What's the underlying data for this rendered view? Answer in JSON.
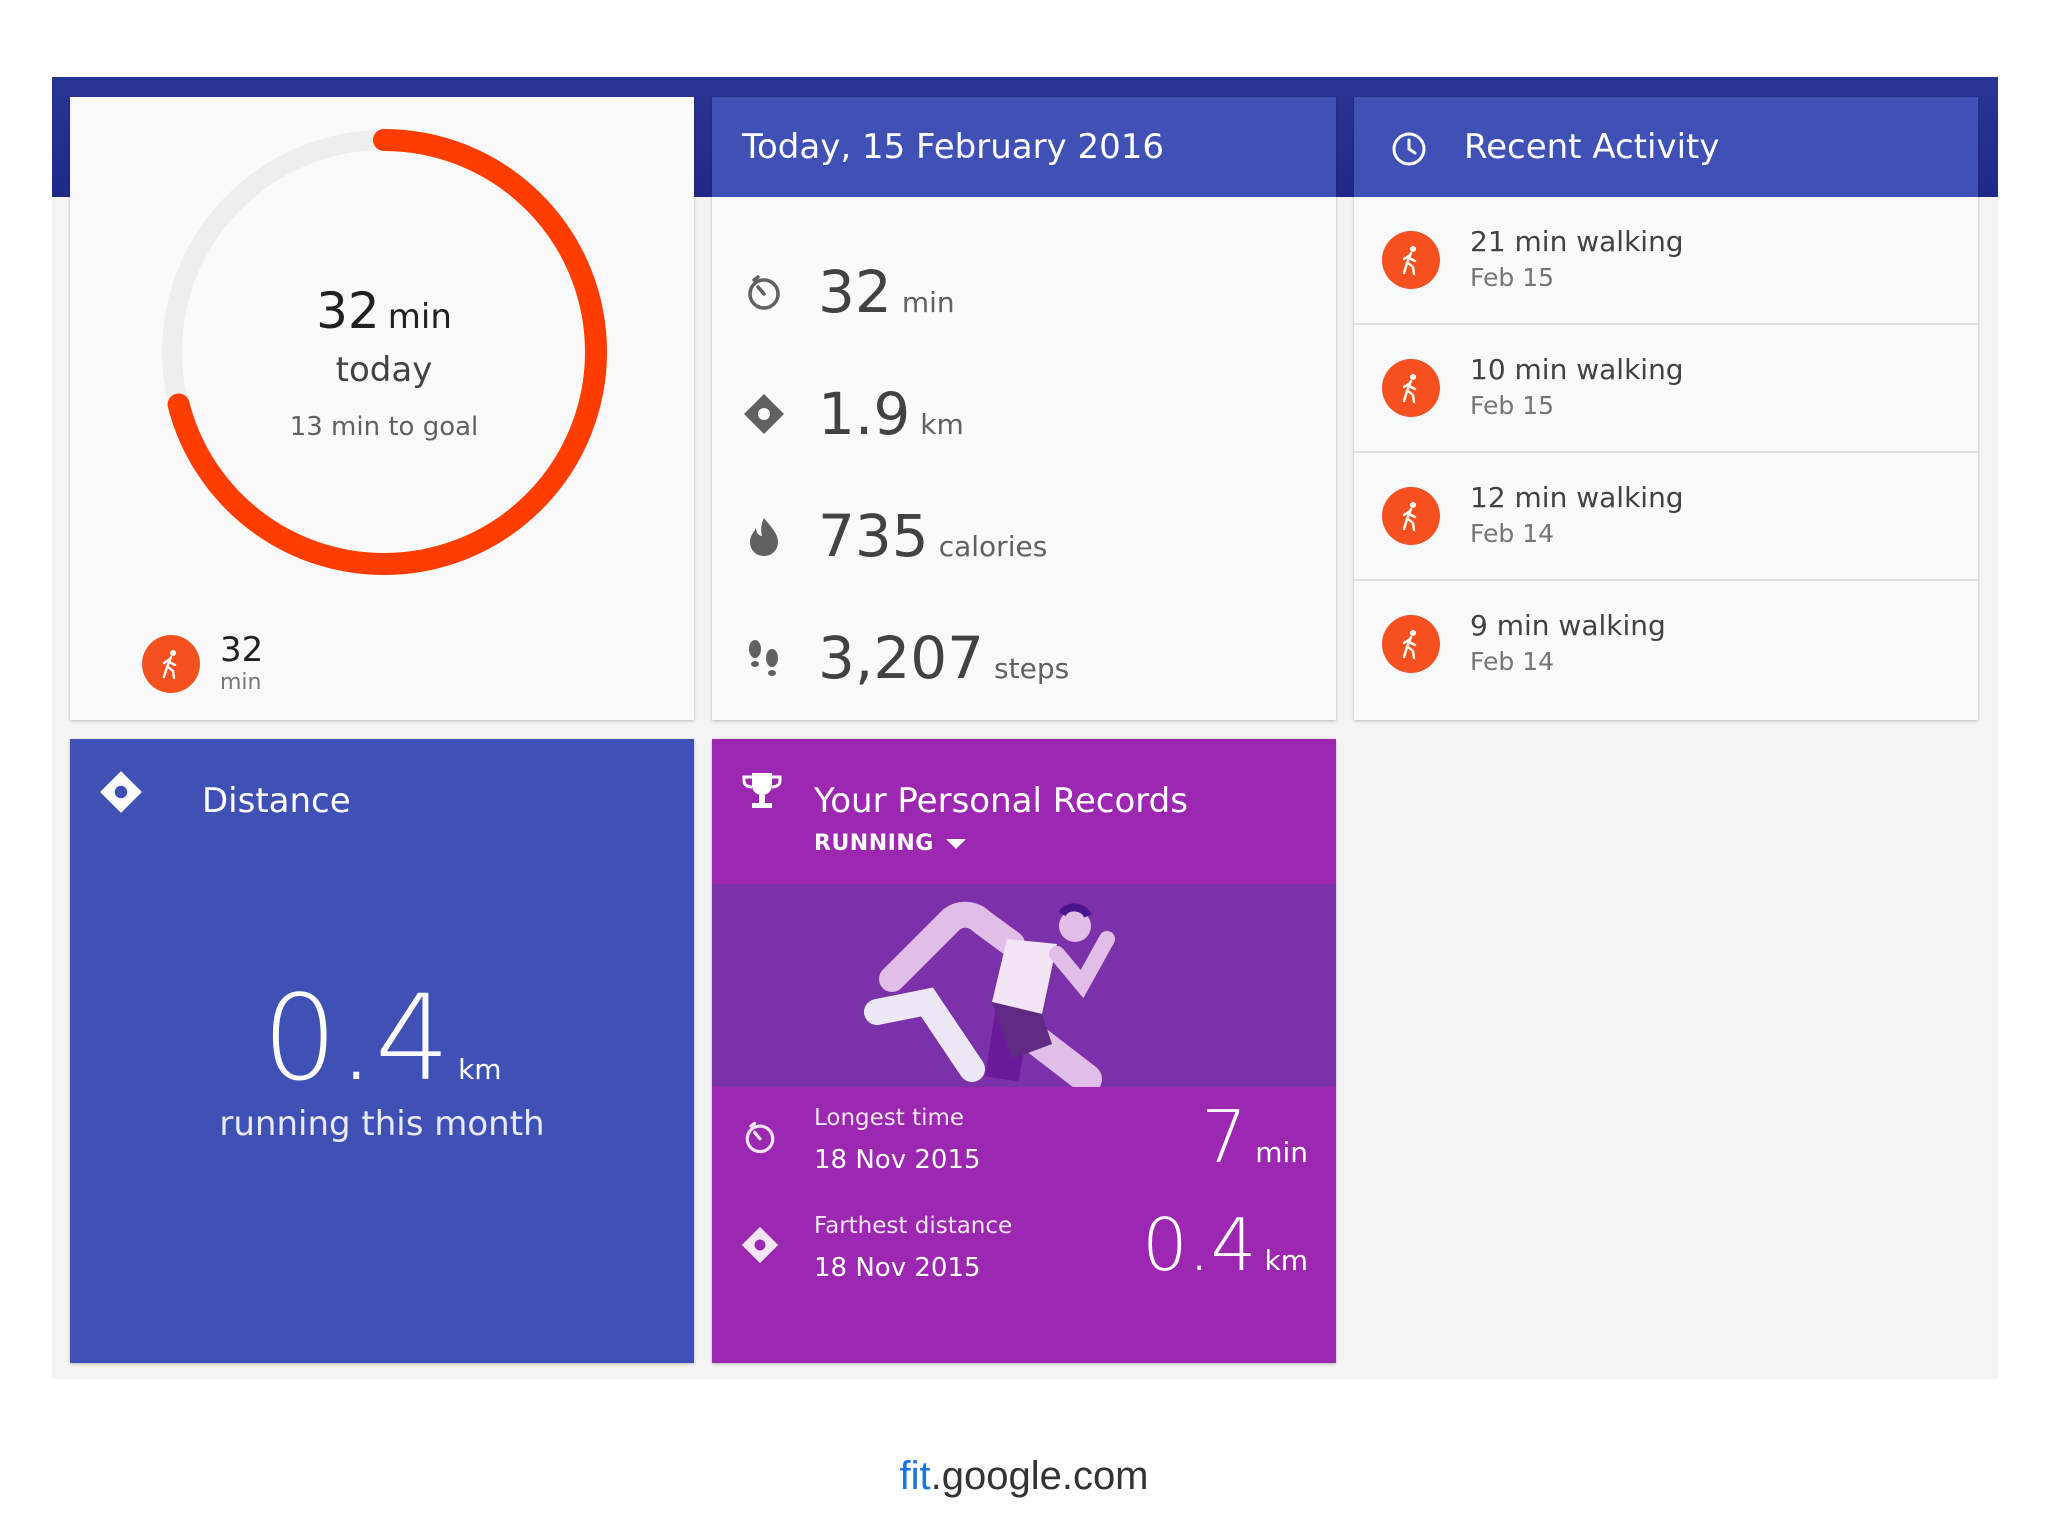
{
  "goal": {
    "value": "32",
    "unit": "min",
    "label": "today",
    "remaining": "13 min to goal",
    "progress": 0.71,
    "mini_value": "32",
    "mini_unit": "min",
    "ring_color": "#ff3d00"
  },
  "today": {
    "title": "Today, 15 February 2016",
    "stats": [
      {
        "icon": "timer-icon",
        "value": "32",
        "unit": "min"
      },
      {
        "icon": "pin-icon",
        "value": "1.9",
        "unit": "km"
      },
      {
        "icon": "flame-icon",
        "value": "735",
        "unit": "calories"
      },
      {
        "icon": "footsteps-icon",
        "value": "3,207",
        "unit": "steps"
      }
    ]
  },
  "recent": {
    "title": "Recent Activity",
    "items": [
      {
        "title": "21 min walking",
        "date": "Feb 15"
      },
      {
        "title": "10 min walking",
        "date": "Feb 15"
      },
      {
        "title": "12 min walking",
        "date": "Feb 14"
      },
      {
        "title": "9 min walking",
        "date": "Feb 14"
      }
    ]
  },
  "distance": {
    "title": "Distance",
    "value": "0.4",
    "unit": "km",
    "subtitle": "running this month"
  },
  "records": {
    "title": "Your Personal Records",
    "sport": "RUNNING",
    "rows": [
      {
        "label": "Longest time",
        "date": "18 Nov 2015",
        "value": "7",
        "unit": "min"
      },
      {
        "label": "Farthest distance",
        "date": "18 Nov 2015",
        "value": "0.4",
        "unit": "km"
      }
    ]
  },
  "footer": {
    "fit": "fit",
    "rest": ".google.com"
  },
  "colors": {
    "accent_orange": "#f4511e",
    "indigo": "#3f51b5",
    "purple": "#9c27b0"
  }
}
